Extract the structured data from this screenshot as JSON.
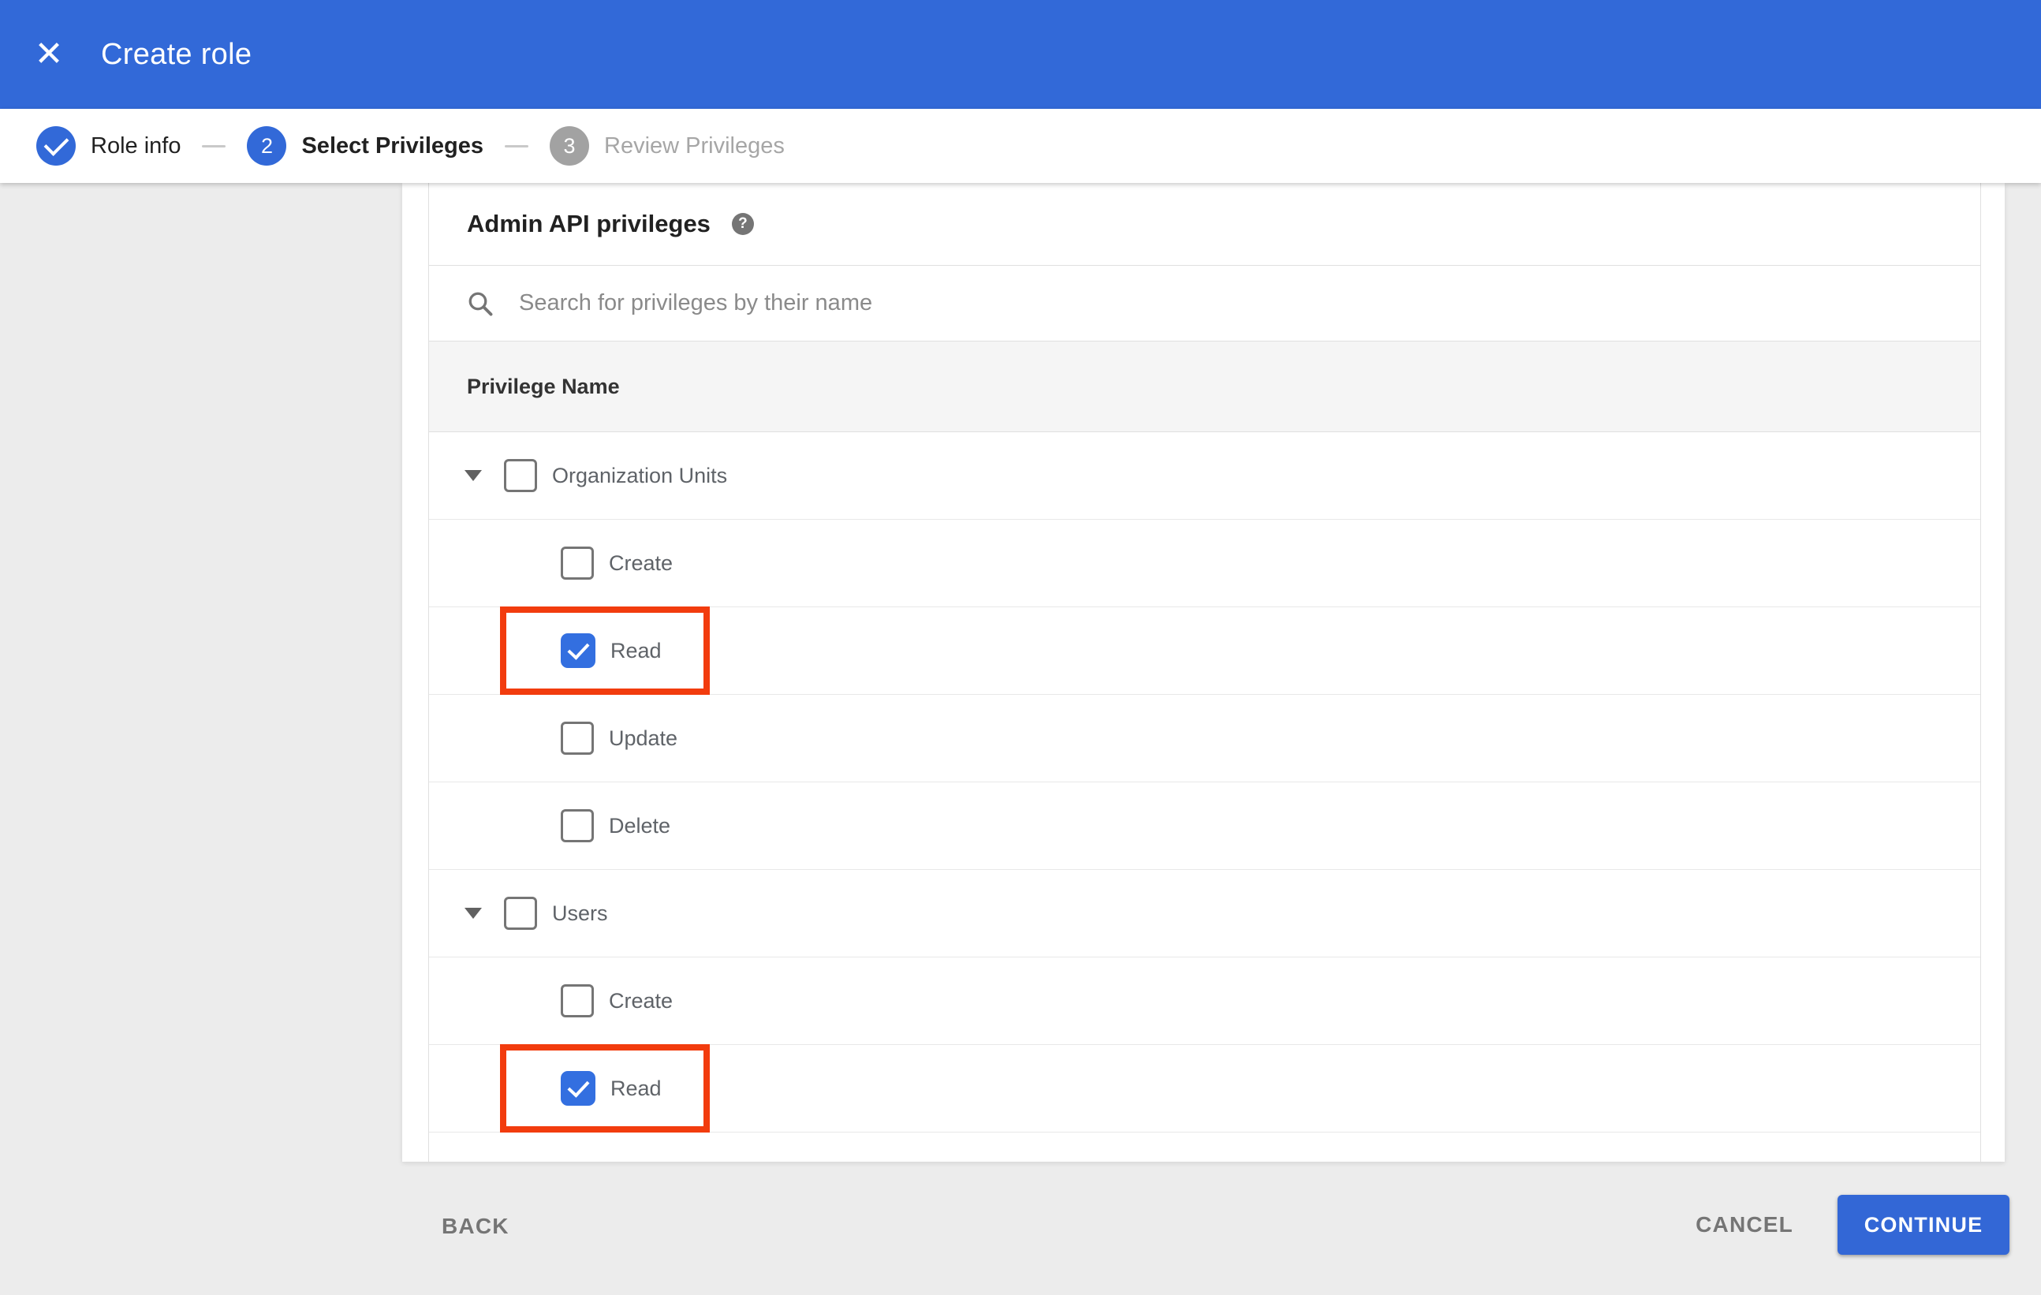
{
  "header": {
    "title": "Create role",
    "close_icon": "✕"
  },
  "stepper": {
    "steps": [
      {
        "label": "Role info",
        "state": "complete"
      },
      {
        "number": "2",
        "label": "Select Privileges",
        "state": "active"
      },
      {
        "number": "3",
        "label": "Review Privileges",
        "state": "upcoming"
      }
    ]
  },
  "panel": {
    "title": "Admin API privileges",
    "help_icon": "?",
    "search": {
      "value": "",
      "placeholder": "Search for privileges by their name"
    },
    "table": {
      "header": "Privilege Name",
      "groups": [
        {
          "label": "Organization Units",
          "checked": false,
          "expanded": true,
          "children": [
            {
              "label": "Create",
              "checked": false,
              "highlighted": false
            },
            {
              "label": "Read",
              "checked": true,
              "highlighted": true
            },
            {
              "label": "Update",
              "checked": false,
              "highlighted": false
            },
            {
              "label": "Delete",
              "checked": false,
              "highlighted": false
            }
          ]
        },
        {
          "label": "Users",
          "checked": false,
          "expanded": true,
          "children": [
            {
              "label": "Create",
              "checked": false,
              "highlighted": false
            },
            {
              "label": "Read",
              "checked": true,
              "highlighted": true
            }
          ]
        }
      ]
    }
  },
  "footer": {
    "back_label": "BACK",
    "cancel_label": "CANCEL",
    "continue_label": "CONTINUE"
  },
  "colors": {
    "app_bar_blue": "#3269d8",
    "button_blue": "#3367d6",
    "checkbox_blue": "#336fe0",
    "highlight_red": "#f23c0e",
    "backdrop_gray": "#ececec"
  }
}
